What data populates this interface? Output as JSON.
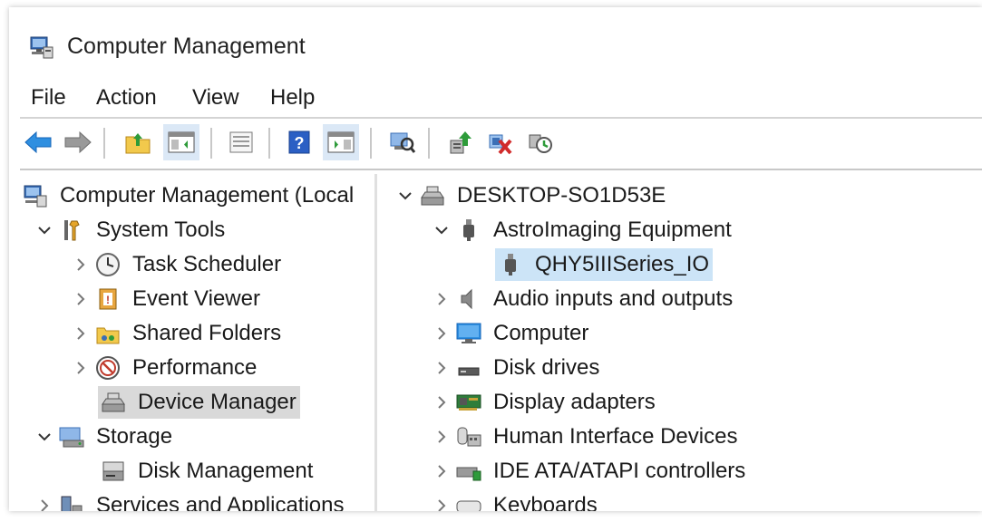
{
  "window": {
    "title": "Computer Management"
  },
  "menu": {
    "items": [
      "File",
      "Action",
      "View",
      "Help"
    ]
  },
  "toolbar": {
    "buttons": [
      "back-icon",
      "forward-icon",
      "up-folder-icon",
      "show-hide-console-tree-icon",
      "export-list-icon",
      "help-icon",
      "show-hide-action-pane-icon",
      "scan-hardware-icon",
      "update-driver-icon",
      "uninstall-device-icon",
      "rollback-driver-icon"
    ]
  },
  "left_tree": {
    "root": "Computer Management (Local",
    "system_tools": "System Tools",
    "task_scheduler": "Task Scheduler",
    "event_viewer": "Event Viewer",
    "shared_folders": "Shared Folders",
    "performance": "Performance",
    "device_manager": "Device Manager",
    "storage": "Storage",
    "disk_management": "Disk Management",
    "services": "Services and Applications"
  },
  "right_tree": {
    "computer_name": "DESKTOP-SO1D53E",
    "astro": "AstroImaging Equipment",
    "qhy": "QHY5IIISeries_IO",
    "audio": "Audio inputs and outputs",
    "computer": "Computer",
    "disk_drives": "Disk drives",
    "display": "Display adapters",
    "hid": "Human Interface Devices",
    "ide": "IDE ATA/ATAPI controllers",
    "keyboards": "Keyboards"
  },
  "colors": {
    "selection_grey": "#d9d9d9",
    "selection_blue": "#cce4f7",
    "accent": "#1e6fd9"
  }
}
